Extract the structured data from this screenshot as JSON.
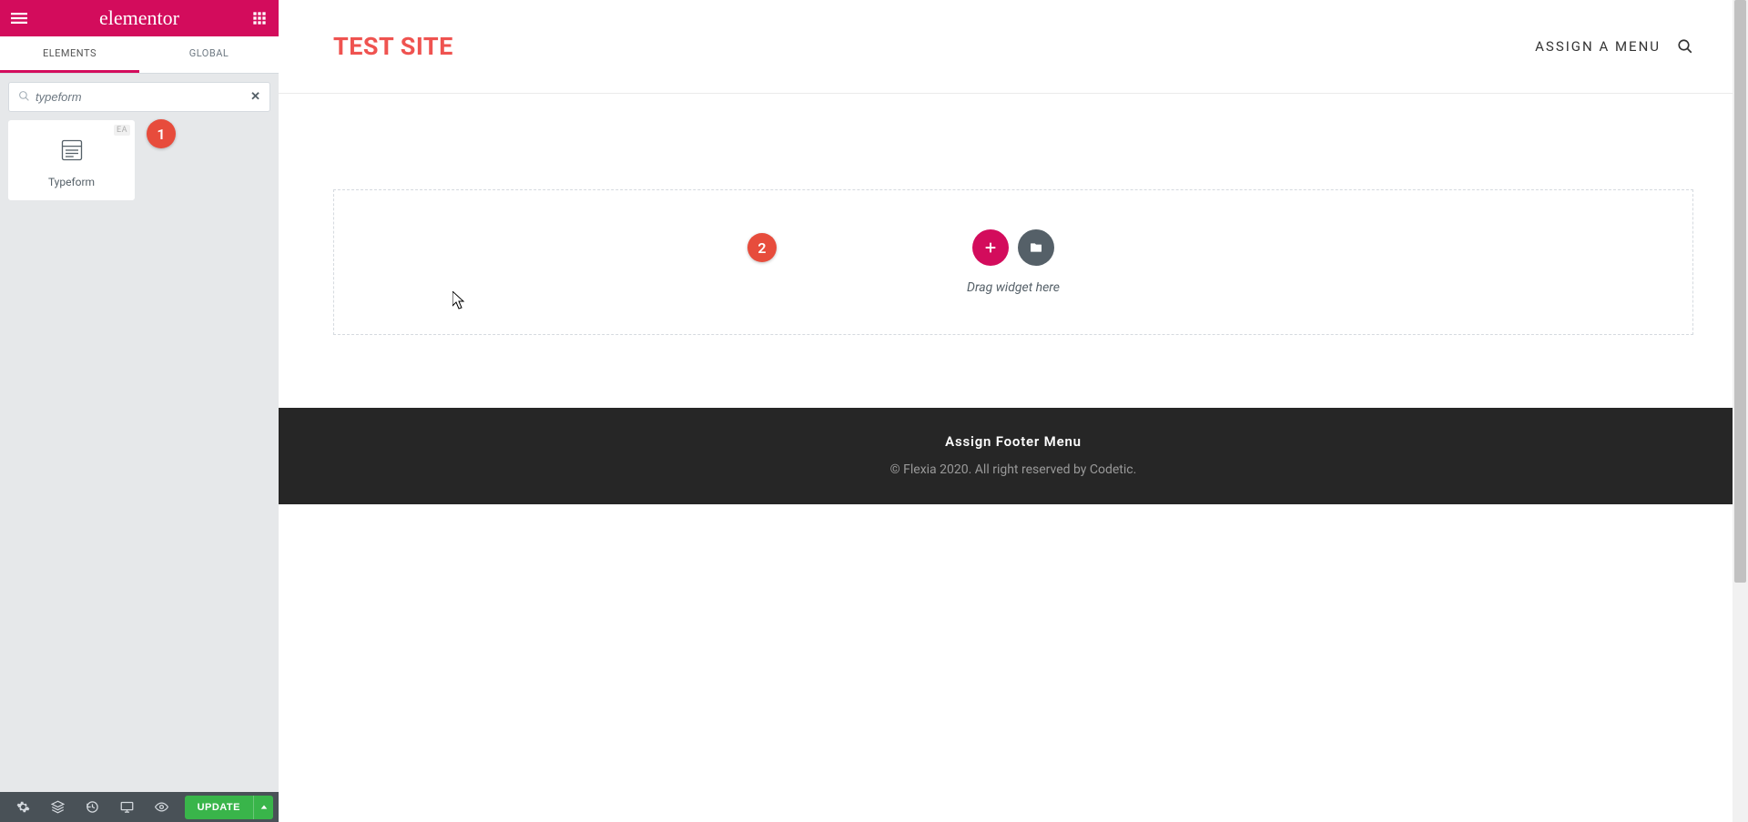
{
  "sidebar": {
    "brand": "elementor",
    "tabs": {
      "elements": "ELEMENTS",
      "global": "GLOBAL"
    },
    "search": {
      "value": "typeform",
      "clear": "✕"
    },
    "widgets": [
      {
        "label": "Typeform",
        "badge": "EA"
      }
    ],
    "footer": {
      "update_label": "UPDATE"
    }
  },
  "site": {
    "title": "TEST SITE",
    "nav_assign": "ASSIGN A MENU"
  },
  "dropzone": {
    "hint": "Drag widget here"
  },
  "footer": {
    "title": "Assign Footer Menu",
    "copyright": "© Flexia 2020. All right reserved by Codetic."
  },
  "markers": {
    "one": "1",
    "two": "2"
  }
}
